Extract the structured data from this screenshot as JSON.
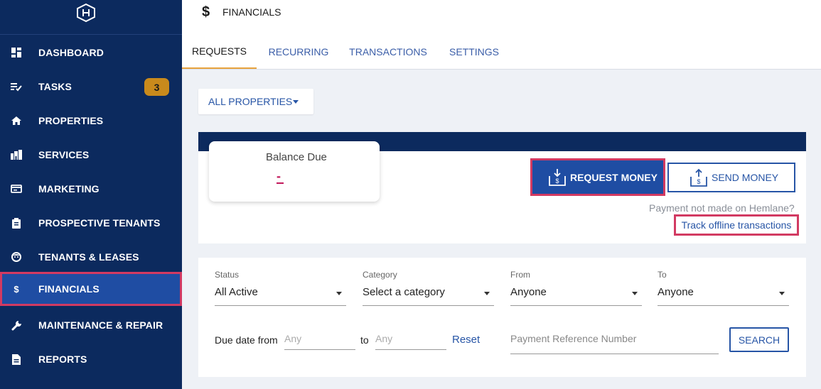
{
  "sidebar": {
    "logo_icon": "hexagon-h-logo",
    "items": [
      {
        "label": "DASHBOARD",
        "icon": "dashboard-icon"
      },
      {
        "label": "TASKS",
        "icon": "tasks-icon",
        "badge": "3"
      },
      {
        "label": "PROPERTIES",
        "icon": "home-icon"
      },
      {
        "label": "SERVICES",
        "icon": "services-icon"
      },
      {
        "label": "MARKETING",
        "icon": "marketing-icon"
      },
      {
        "label": "PROSPECTIVE TENANTS",
        "icon": "clipboard-icon"
      },
      {
        "label": "TENANTS & LEASES",
        "icon": "tenant-face-icon"
      },
      {
        "label": "FINANCIALS",
        "icon": "dollar-icon",
        "active": true
      },
      {
        "label": "MAINTENANCE & REPAIR",
        "icon": "wrench-icon"
      },
      {
        "label": "REPORTS",
        "icon": "document-icon"
      }
    ]
  },
  "header": {
    "icon": "dollar-icon",
    "dollar_glyph": "$",
    "title": "FINANCIALS"
  },
  "tabs": [
    {
      "label": "REQUESTS",
      "active": true
    },
    {
      "label": "RECURRING"
    },
    {
      "label": "TRANSACTIONS"
    },
    {
      "label": "SETTINGS"
    }
  ],
  "property_filter": {
    "selected": "ALL PROPERTIES"
  },
  "balance": {
    "label": "Balance Due",
    "value": "-"
  },
  "actions": {
    "request_label": "REQUEST MONEY",
    "send_label": "SEND MONEY",
    "offline_question": "Payment not made on Hemlane?",
    "offline_link": "Track offline transactions"
  },
  "filters": {
    "status": {
      "label": "Status",
      "value": "All Active"
    },
    "category": {
      "label": "Category",
      "value": "Select a category"
    },
    "from": {
      "label": "From",
      "value": "Anyone"
    },
    "to": {
      "label": "To",
      "value": "Anyone"
    },
    "due_date_from_label": "Due date from",
    "due_date_from_placeholder": "Any",
    "to_label": "to",
    "due_date_to_placeholder": "Any",
    "reset_label": "Reset",
    "reference_placeholder": "Payment Reference Number",
    "search_label": "SEARCH"
  },
  "colors": {
    "sidebar_bg": "#0c2a5e",
    "accent_blue": "#1f4da3",
    "highlight_red": "#d23a62",
    "badge_orange": "#c98a1c",
    "active_tab_underline": "#e8a33d"
  }
}
